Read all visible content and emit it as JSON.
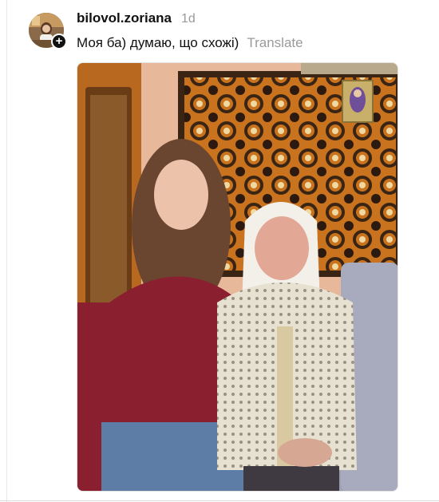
{
  "post": {
    "username": "bilovol.zoriana",
    "timestamp": "1d",
    "caption": "Моя ба) думаю, що схожі)",
    "translate_label": "Translate",
    "follow_symbol": "+"
  },
  "icons": {
    "follow": "plus-icon"
  },
  "colors": {
    "text_primary": "#111111",
    "text_secondary": "#9a9a9a"
  }
}
